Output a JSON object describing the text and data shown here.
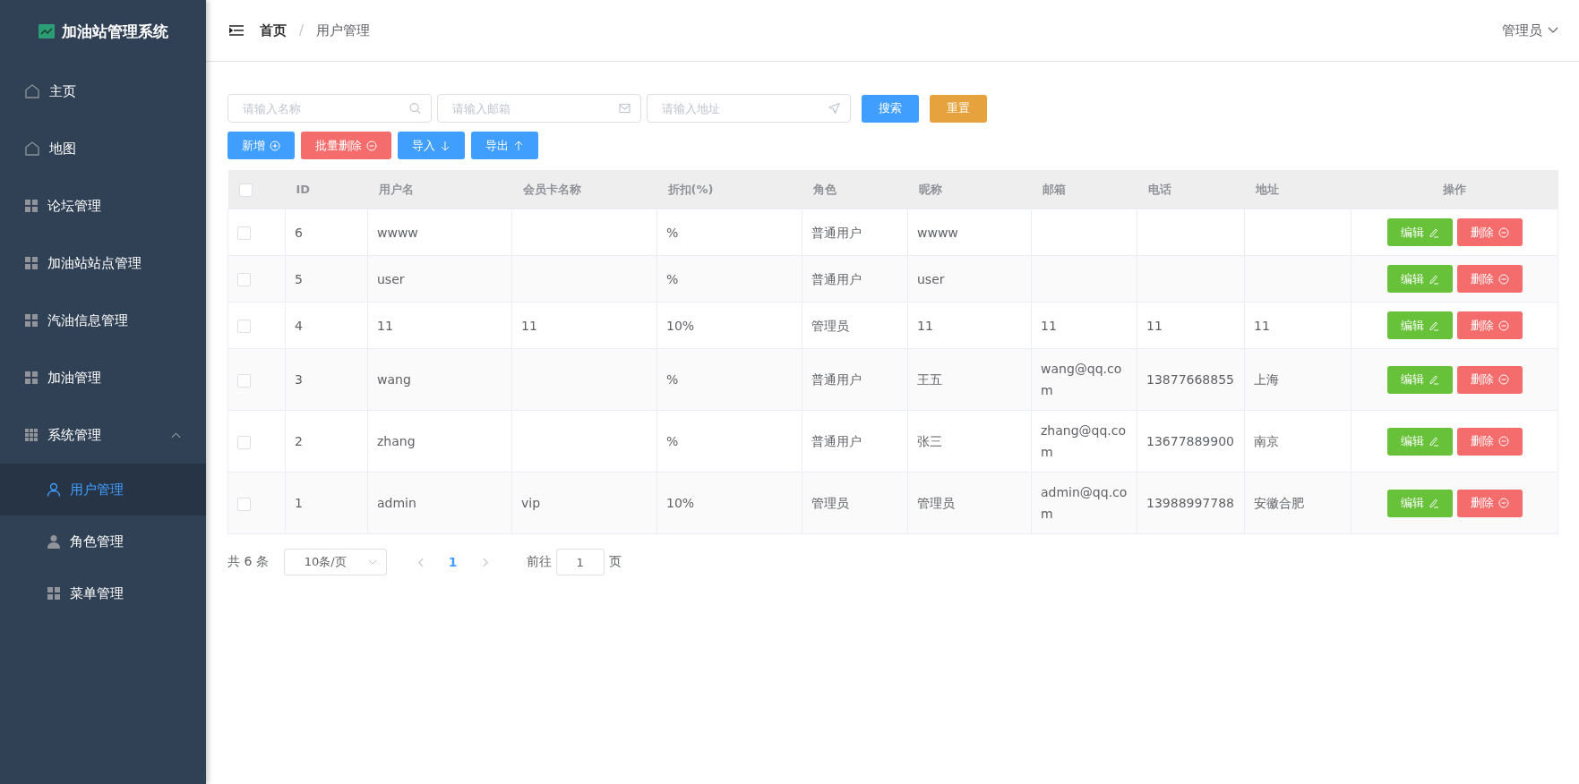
{
  "sidebar": {
    "title": "加油站管理系统",
    "items": [
      {
        "label": "主页",
        "kind": "home",
        "selected": false
      },
      {
        "label": "地图",
        "kind": "home",
        "selected": false
      },
      {
        "label": "论坛管理",
        "kind": "grid",
        "selected": false
      },
      {
        "label": "加油站站点管理",
        "kind": "grid",
        "selected": false
      },
      {
        "label": "汽油信息管理",
        "kind": "grid",
        "selected": false
      },
      {
        "label": "加油管理",
        "kind": "grid",
        "selected": false
      },
      {
        "label": "系统管理",
        "kind": "apps",
        "selected": false,
        "expanded": true,
        "children": [
          {
            "label": "用户管理",
            "kind": "user",
            "selected": true
          },
          {
            "label": "角色管理",
            "kind": "person",
            "selected": false
          },
          {
            "label": "菜单管理",
            "kind": "grid",
            "selected": false
          }
        ]
      }
    ]
  },
  "header": {
    "breadcrumb": [
      "首页",
      "用户管理"
    ],
    "separator": "/",
    "user": "管理员"
  },
  "search": {
    "fields": [
      {
        "placeholder": "请输入名称",
        "kind": "search"
      },
      {
        "placeholder": "请输入邮箱",
        "kind": "mail"
      },
      {
        "placeholder": "请输入地址",
        "kind": "location"
      }
    ],
    "buttons": [
      {
        "label": "搜索",
        "kind": "primary"
      },
      {
        "label": "重置",
        "kind": "warning"
      }
    ]
  },
  "toolbar": [
    {
      "label": "新增",
      "kind": "add"
    },
    {
      "label": "批量删除",
      "kind": "batch_delete"
    },
    {
      "label": "导入",
      "kind": "import"
    },
    {
      "label": "导出",
      "kind": "export"
    }
  ],
  "table": {
    "columns": [
      "ID",
      "用户名",
      "会员卡名称",
      "折扣(%)",
      "角色",
      "昵称",
      "邮箱",
      "电话",
      "地址",
      "操作"
    ],
    "select_all_checked": false,
    "rows": [
      {
        "checked": false,
        "cells": [
          "6",
          "wwww",
          "",
          "%",
          "普通用户",
          "wwww",
          "",
          "",
          ""
        ],
        "actions": [
          "编辑",
          "删除"
        ]
      },
      {
        "checked": false,
        "cells": [
          "5",
          "user",
          "",
          "%",
          "普通用户",
          "user",
          "",
          "",
          ""
        ],
        "actions": [
          "编辑",
          "删除"
        ]
      },
      {
        "checked": false,
        "cells": [
          "4",
          "11",
          "11",
          "10%",
          "管理员",
          "11",
          "11",
          "11",
          "11"
        ],
        "actions": [
          "编辑",
          "删除"
        ]
      },
      {
        "checked": false,
        "cells": [
          "3",
          "wang",
          "",
          "%",
          "普通用户",
          "王五",
          "wang@qq.com",
          "13877668855",
          "上海"
        ],
        "actions": [
          "编辑",
          "删除"
        ]
      },
      {
        "checked": false,
        "cells": [
          "2",
          "zhang",
          "",
          "%",
          "普通用户",
          "张三",
          "zhang@qq.com",
          "13677889900",
          "南京"
        ],
        "actions": [
          "编辑",
          "删除"
        ]
      },
      {
        "checked": false,
        "cells": [
          "1",
          "admin",
          "vip",
          "10%",
          "管理员",
          "管理员",
          "admin@qq.com",
          "13988997788",
          "安徽合肥"
        ],
        "actions": [
          "编辑",
          "删除"
        ]
      }
    ]
  },
  "pagination": {
    "total": "共 6 条",
    "page_size": "10条/页",
    "pages": [
      {
        "label": "1",
        "selected": true
      }
    ],
    "goto_label": "前往",
    "goto_value": "1",
    "goto_suffix": "页"
  }
}
